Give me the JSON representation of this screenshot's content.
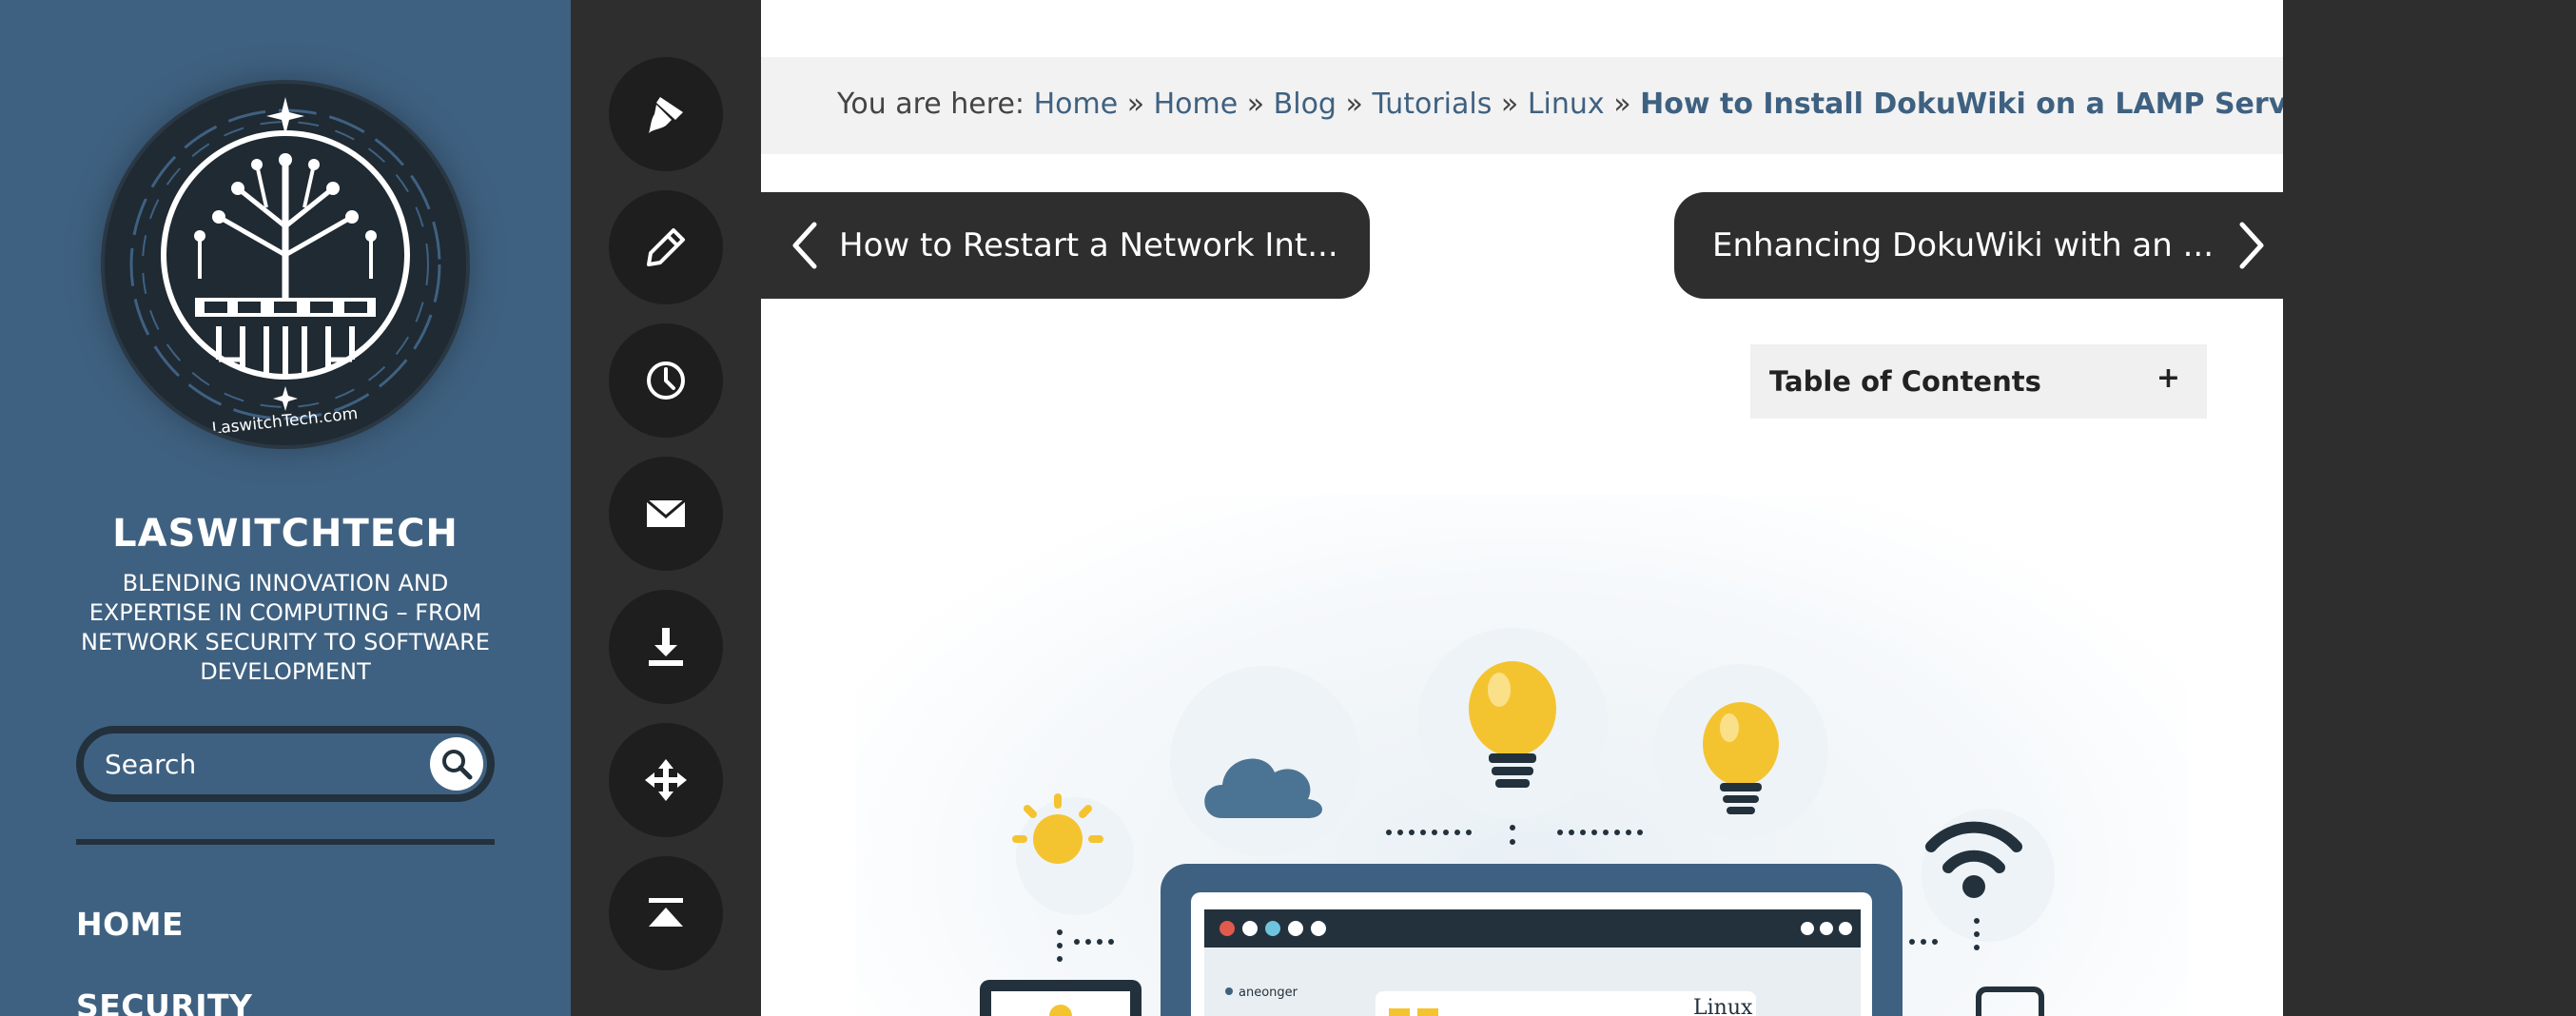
{
  "sidebar": {
    "logo_text": "LaswitchTech.com",
    "site_title": "LASWITCHTECH",
    "tagline": "BLENDING INNOVATION AND EXPERTISE IN COMPUTING – FROM NETWORK SECURITY TO SOFTWARE DEVELOPMENT",
    "search": {
      "placeholder": "Search",
      "button_icon": "search-icon"
    },
    "nav": [
      {
        "label": "HOME"
      },
      {
        "label": "SECURITY"
      }
    ]
  },
  "toolbar": {
    "buttons": [
      {
        "icon": "paint-brush-icon",
        "title": "Customize"
      },
      {
        "icon": "pencil-icon",
        "title": "Edit"
      },
      {
        "icon": "clock-icon",
        "title": "History"
      },
      {
        "icon": "envelope-icon",
        "title": "Email"
      },
      {
        "icon": "download-icon",
        "title": "Download"
      },
      {
        "icon": "move-icon",
        "title": "Move"
      },
      {
        "icon": "back-to-top-icon",
        "title": "Back to top"
      }
    ]
  },
  "breadcrumb": {
    "prefix": "You are here:",
    "items": [
      "Home",
      "Home",
      "Blog",
      "Tutorials",
      "Linux"
    ],
    "separator": "»",
    "current": "How to Install DokuWiki on a LAMP Server"
  },
  "post_nav": {
    "prev_label": "How to Restart a Network Int...",
    "next_label": "Enhancing DokuWiki with an ..."
  },
  "toc": {
    "title": "Table of Contents",
    "toggle": "+"
  },
  "hero": {
    "window_label": "Linux",
    "app_label": "aneonger"
  },
  "colors": {
    "sidebar_bg": "#3f6181",
    "dark_bg": "#2e2e2e",
    "accent": "#3f6181",
    "bulb_yellow": "#f4c430"
  }
}
